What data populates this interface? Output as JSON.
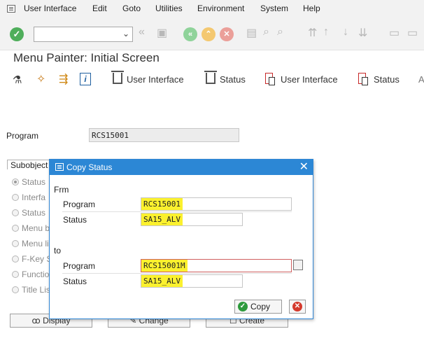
{
  "menubar": {
    "items": [
      "User Interface",
      "Edit",
      "Goto",
      "Utilities",
      "Environment",
      "System",
      "Help"
    ]
  },
  "page": {
    "title": "Menu Painter: Initial Screen"
  },
  "app_toolbar": {
    "items": [
      "User Interface",
      "Status",
      "User Interface",
      "Status",
      "A"
    ]
  },
  "main": {
    "program_label": "Program",
    "program_value": "RCS15001",
    "tab_label": "Subobject",
    "radio_items": [
      "Status",
      "Interfa",
      "Status",
      "Menu b",
      "Menu li",
      "F-Key S",
      "Functio",
      "Title Lis"
    ],
    "buttons": [
      "Display",
      "Change",
      "Create"
    ]
  },
  "dialog": {
    "title": "Copy Status",
    "from_label": "Frm",
    "to_label": "to",
    "from_program_label": "Program",
    "from_program_value": "RCS15001",
    "from_status_label": "Status",
    "from_status_value": "SA15_ALV",
    "to_program_label": "Program",
    "to_program_value": "RCS15001M",
    "to_status_label": "Status",
    "to_status_value": "SA15_ALV",
    "copy_label": "Copy"
  },
  "colors": {
    "dialog_titlebar": "#2c87d5",
    "highlight": "#fbf12e",
    "ok_green": "#2d9a3c",
    "cancel_red": "#d43a2d"
  }
}
